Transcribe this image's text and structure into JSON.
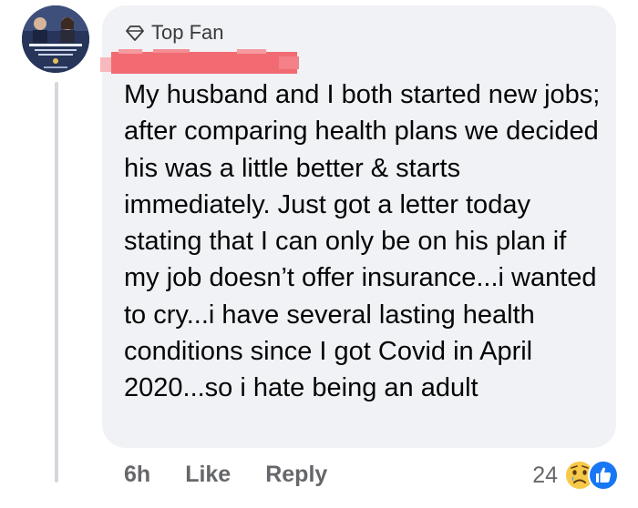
{
  "comment": {
    "badge_label": "Top Fan",
    "badge_icon": "diamond-icon",
    "text": "My husband and I both started new jobs; after comparing health plans we decided his was a little better & starts immediately. Just got a letter today stating that I can only be on his plan if my job doesn’t offer insurance...i wanted to cry...i have several lasting health conditions since I got Covid in April 2020...so i hate being an adult"
  },
  "actions": {
    "timestamp": "6h",
    "like_label": "Like",
    "reply_label": "Reply"
  },
  "reactions": {
    "count": "24",
    "icons": [
      "sad-reaction-icon",
      "like-reaction-icon"
    ]
  },
  "colors": {
    "bubble_background": "#f0f2f5",
    "text": "#050505",
    "secondary_text": "#65676b",
    "redaction": "#f26b72",
    "like_blue": "#1877f2",
    "sad_yellow": "#f7c948"
  }
}
